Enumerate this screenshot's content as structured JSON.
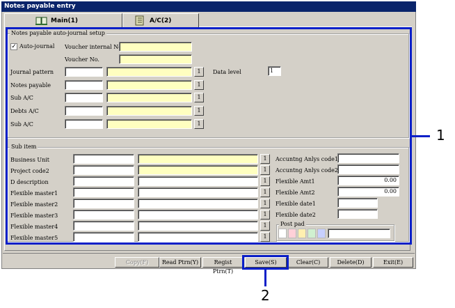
{
  "window": {
    "title": "Notes payable entry"
  },
  "tabs": [
    {
      "label": "Main(1)"
    },
    {
      "label": "A/C(2)"
    }
  ],
  "journal_group": {
    "title": "Notes payable auto-journal setup",
    "auto_journal_label": "Auto-journal",
    "auto_journal_checked": true,
    "voucher_internal_label": "Voucher internal No.",
    "voucher_no_label": "Voucher No.",
    "data_level_label": "Data level",
    "data_level_value": "1",
    "rows": [
      {
        "label": "Journal pattern"
      },
      {
        "label": "Notes payable"
      },
      {
        "label": "Sub A/C"
      },
      {
        "label": "Debts A/C"
      },
      {
        "label": "Sub A/C"
      }
    ],
    "lookup_label": "1"
  },
  "sub_item_group": {
    "title": "Sub item",
    "left_rows": [
      {
        "label": "Business Unit"
      },
      {
        "label": "Project code2"
      },
      {
        "label": "D description"
      },
      {
        "label": "Flexible master1"
      },
      {
        "label": "Flexible master2"
      },
      {
        "label": "Flexible master3"
      },
      {
        "label": "Flexible master4"
      },
      {
        "label": "Flexible master5"
      }
    ],
    "right_rows": [
      {
        "label": "Accuntng Anlys code1",
        "value": ""
      },
      {
        "label": "Accuntng Anlys code2",
        "value": ""
      },
      {
        "label": "Flexible Amt1",
        "value": "0.00"
      },
      {
        "label": "Flexible Amt2",
        "value": "0.00"
      },
      {
        "label": "Flexible date1",
        "value": ""
      },
      {
        "label": "Flexible date2",
        "value": ""
      }
    ],
    "post_pad_label": "Post pad",
    "post_pad_colors": [
      "#ffffff",
      "#ffd0d8",
      "#fff0b0",
      "#d0f0d0",
      "#c8d0ff"
    ]
  },
  "buttons": [
    {
      "label": "Copy(F)",
      "enabled": false
    },
    {
      "label": "Read Ptrn(Y)",
      "enabled": true
    },
    {
      "label": "Regist Ptrn(T)",
      "enabled": true
    },
    {
      "label": "Save(S)",
      "enabled": true
    },
    {
      "label": "Clear(C)",
      "enabled": true
    },
    {
      "label": "Delete(D)",
      "enabled": true
    },
    {
      "label": "Exit(E)",
      "enabled": true
    }
  ],
  "callouts": [
    "1",
    "2"
  ]
}
